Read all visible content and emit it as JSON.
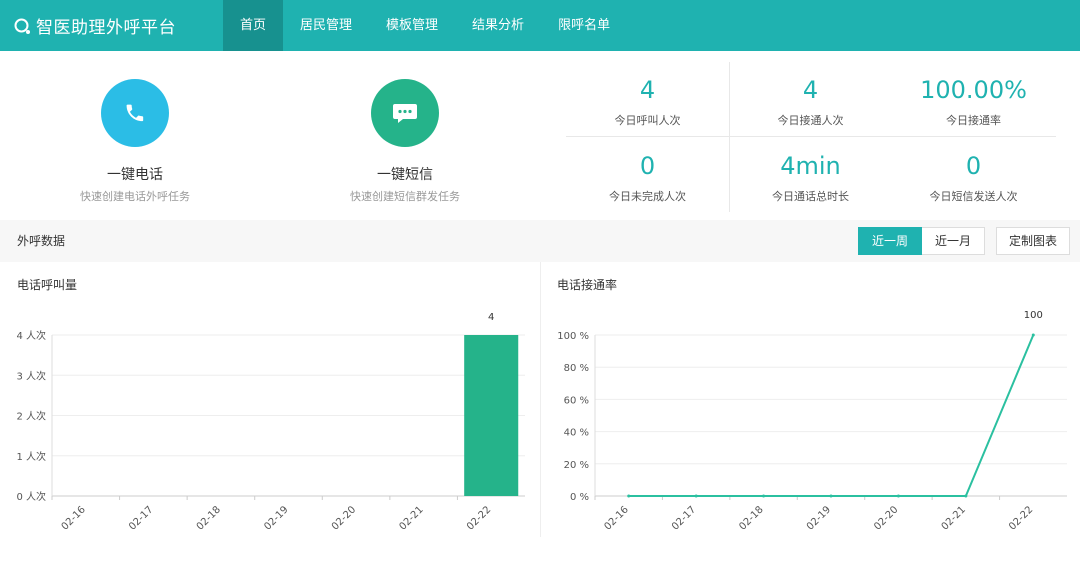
{
  "header": {
    "app_title": "智医助理外呼平台",
    "nav": [
      {
        "label": "首页",
        "active": true
      },
      {
        "label": "居民管理",
        "active": false
      },
      {
        "label": "模板管理",
        "active": false
      },
      {
        "label": "结果分析",
        "active": false
      },
      {
        "label": "限呼名单",
        "active": false
      }
    ]
  },
  "actions": {
    "call": {
      "icon": "phone-icon",
      "title": "一键电话",
      "subtitle": "快速创建电话外呼任务",
      "color": "#2bbde6"
    },
    "sms": {
      "icon": "message-icon",
      "title": "一键短信",
      "subtitle": "快速创建短信群发任务",
      "color": "#25b38a"
    }
  },
  "stats": [
    {
      "value": "4",
      "label": "今日呼叫人次"
    },
    {
      "value": "4",
      "label": "今日接通人次"
    },
    {
      "value": "100.00%",
      "label": "今日接通率"
    },
    {
      "value": "0",
      "label": "今日未完成人次"
    },
    {
      "value": "4min",
      "label": "今日通话总时长"
    },
    {
      "value": "0",
      "label": "今日短信发送人次"
    }
  ],
  "section": {
    "title": "外呼数据",
    "range_buttons": [
      {
        "label": "近一周",
        "active": true
      },
      {
        "label": "近一月",
        "active": false
      }
    ],
    "custom_button": "定制图表"
  },
  "colors": {
    "accent": "#1fb2b0",
    "nav_active": "#17918f",
    "bar": "#25b38a",
    "line": "#2bc0a0"
  },
  "chart_data": [
    {
      "type": "bar",
      "title": "电话呼叫量",
      "categories": [
        "02-16",
        "02-17",
        "02-18",
        "02-19",
        "02-20",
        "02-21",
        "02-22"
      ],
      "values": [
        0,
        0,
        0,
        0,
        0,
        0,
        4
      ],
      "data_labels": [
        "",
        "",
        "",
        "",
        "",
        "",
        "4"
      ],
      "y_ticks": [
        "0 人次",
        "1 人次",
        "2 人次",
        "3 人次",
        "4 人次"
      ],
      "ylim": [
        0,
        4
      ],
      "grid": true
    },
    {
      "type": "line",
      "title": "电话接通率",
      "categories": [
        "02-16",
        "02-17",
        "02-18",
        "02-19",
        "02-20",
        "02-21",
        "02-22"
      ],
      "values": [
        0,
        0,
        0,
        0,
        0,
        0,
        100
      ],
      "data_labels": [
        "",
        "",
        "",
        "",
        "",
        "",
        "100"
      ],
      "y_ticks": [
        "0 %",
        "20 %",
        "40 %",
        "60 %",
        "80 %",
        "100 %"
      ],
      "ylim": [
        0,
        100
      ],
      "grid": true
    }
  ]
}
